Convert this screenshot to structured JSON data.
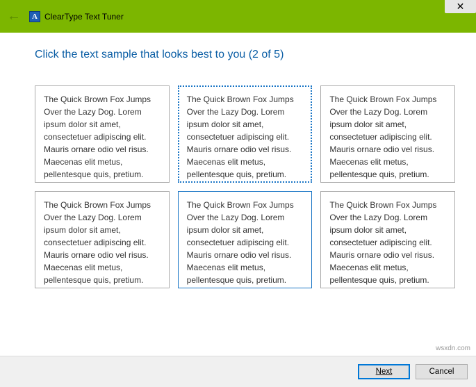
{
  "title_bar": {
    "app_name": "ClearType Text Tuner",
    "icon_letter": "A"
  },
  "heading": "Click the text sample that looks best to you (2 of 5)",
  "sample_text": "The Quick Brown Fox Jumps Over the Lazy Dog. Lorem ipsum dolor sit amet, consectetuer adipiscing elit. Mauris ornare odio vel risus. Maecenas elit metus, pellentesque quis, pretium.",
  "samples": [
    {
      "selected": false
    },
    {
      "selected": true,
      "selection_style": "top"
    },
    {
      "selected": false
    },
    {
      "selected": false
    },
    {
      "selected": true,
      "selection_style": "bottom"
    },
    {
      "selected": false
    }
  ],
  "footer": {
    "next_label": "Next",
    "cancel_label": "Cancel"
  },
  "watermark": "wsxdn.com"
}
